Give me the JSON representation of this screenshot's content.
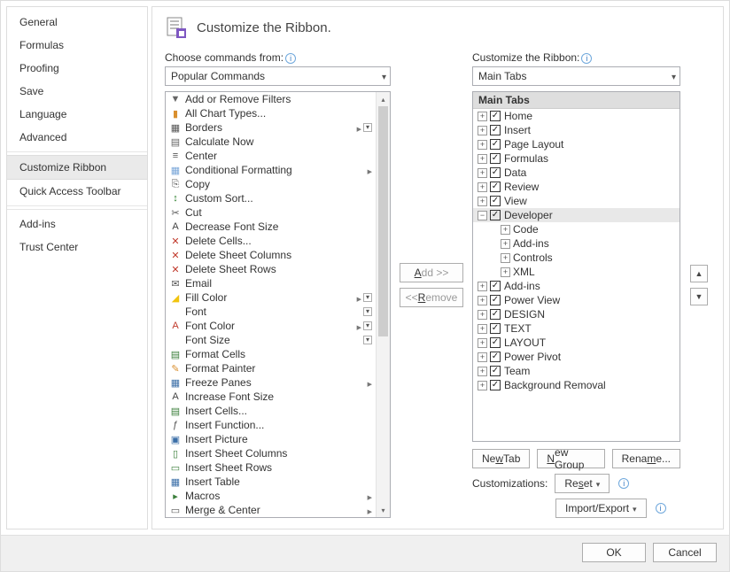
{
  "nav": {
    "items": [
      "General",
      "Formulas",
      "Proofing",
      "Save",
      "Language",
      "Advanced",
      "Customize Ribbon",
      "Quick Access Toolbar",
      "Add-ins",
      "Trust Center"
    ],
    "selected": 6
  },
  "header": {
    "title": "Customize the Ribbon."
  },
  "left": {
    "label": "Choose commands from:",
    "combo": "Popular Commands"
  },
  "right": {
    "label": "Customize the Ribbon:",
    "combo": "Main Tabs",
    "treeTitle": "Main Tabs"
  },
  "commands": [
    {
      "t": "Add or Remove Filters",
      "i": "▼",
      "c": "#666"
    },
    {
      "t": "All Chart Types...",
      "i": "▮",
      "c": "#d98f2e"
    },
    {
      "t": "Borders",
      "i": "▦",
      "c": "#555",
      "sub": 1,
      "dd": 1
    },
    {
      "t": "Calculate Now",
      "i": "▤",
      "c": "#666"
    },
    {
      "t": "Center",
      "i": "≡",
      "c": "#555"
    },
    {
      "t": "Conditional Formatting",
      "i": "▦",
      "c": "#7aa7d9",
      "sub": 1
    },
    {
      "t": "Copy",
      "i": "⎘",
      "c": "#555"
    },
    {
      "t": "Custom Sort...",
      "i": "↕",
      "c": "#2a7e2a"
    },
    {
      "t": "Cut",
      "i": "✂",
      "c": "#555"
    },
    {
      "t": "Decrease Font Size",
      "i": "A",
      "c": "#444"
    },
    {
      "t": "Delete Cells...",
      "i": "✕",
      "c": "#c0392b"
    },
    {
      "t": "Delete Sheet Columns",
      "i": "✕",
      "c": "#c0392b"
    },
    {
      "t": "Delete Sheet Rows",
      "i": "✕",
      "c": "#c0392b"
    },
    {
      "t": "Email",
      "i": "✉",
      "c": "#555"
    },
    {
      "t": "Fill Color",
      "i": "◢",
      "c": "#f1c40f",
      "sub": 1,
      "dd": 1
    },
    {
      "t": "Font",
      "i": "",
      "dd": 1
    },
    {
      "t": "Font Color",
      "i": "A",
      "c": "#c0392b",
      "sub": 1,
      "dd": 1
    },
    {
      "t": "Font Size",
      "i": "",
      "dd": 1
    },
    {
      "t": "Format Cells",
      "i": "▤",
      "c": "#3a7e3a"
    },
    {
      "t": "Format Painter",
      "i": "✎",
      "c": "#d98f2e"
    },
    {
      "t": "Freeze Panes",
      "i": "▦",
      "c": "#3a6ea7",
      "sub": 1
    },
    {
      "t": "Increase Font Size",
      "i": "A",
      "c": "#444"
    },
    {
      "t": "Insert Cells...",
      "i": "▤",
      "c": "#3a7e3a"
    },
    {
      "t": "Insert Function...",
      "i": "ƒ",
      "c": "#555"
    },
    {
      "t": "Insert Picture",
      "i": "▣",
      "c": "#3a6ea7"
    },
    {
      "t": "Insert Sheet Columns",
      "i": "▯",
      "c": "#3a7e3a"
    },
    {
      "t": "Insert Sheet Rows",
      "i": "▭",
      "c": "#3a7e3a"
    },
    {
      "t": "Insert Table",
      "i": "▦",
      "c": "#3a6ea7"
    },
    {
      "t": "Macros",
      "i": "▸",
      "c": "#3a7e3a",
      "sub": 1
    },
    {
      "t": "Merge & Center",
      "i": "▭",
      "c": "#555",
      "sub": 1
    }
  ],
  "tabs": [
    {
      "t": "Home",
      "e": "+",
      "cb": 1
    },
    {
      "t": "Insert",
      "e": "+",
      "cb": 1
    },
    {
      "t": "Page Layout",
      "e": "+",
      "cb": 1
    },
    {
      "t": "Formulas",
      "e": "+",
      "cb": 1
    },
    {
      "t": "Data",
      "e": "+",
      "cb": 1
    },
    {
      "t": "Review",
      "e": "+",
      "cb": 1
    },
    {
      "t": "View",
      "e": "+",
      "cb": 1
    },
    {
      "t": "Developer",
      "e": "−",
      "cb": 1,
      "sel": 1,
      "children": [
        "Code",
        "Add-ins",
        "Controls",
        "XML"
      ]
    },
    {
      "t": "Add-ins",
      "e": "+",
      "cb": 1
    },
    {
      "t": "Power View",
      "e": "+",
      "cb": 1
    },
    {
      "t": "DESIGN",
      "e": "+",
      "cb": 1
    },
    {
      "t": "TEXT",
      "e": "+",
      "cb": 1
    },
    {
      "t": "LAYOUT",
      "e": "+",
      "cb": 1
    },
    {
      "t": "Power Pivot",
      "e": "+",
      "cb": 1
    },
    {
      "t": "Team",
      "e": "+",
      "cb": 1
    },
    {
      "t": "Background Removal",
      "e": "+",
      "cb": 1
    }
  ],
  "mid": {
    "add": "Add >>",
    "remove": "<< Remove"
  },
  "btns": {
    "newTab": "New Tab",
    "newGroup": "New Group",
    "rename": "Rename...",
    "custLabel": "Customizations:",
    "reset": "Reset",
    "import": "Import/Export"
  },
  "footer": {
    "ok": "OK",
    "cancel": "Cancel"
  }
}
